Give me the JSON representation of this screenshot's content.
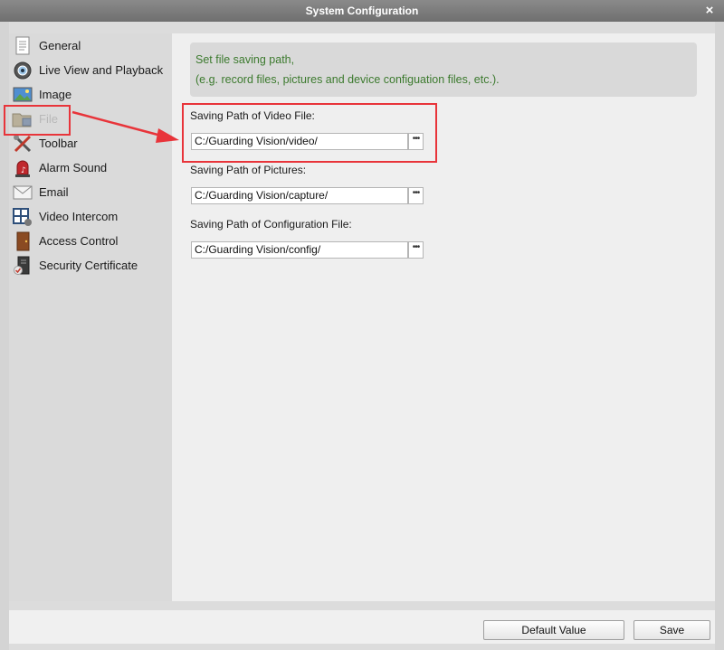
{
  "window": {
    "title": "System Configuration",
    "close_symbol": "×"
  },
  "sidebar": {
    "items": [
      {
        "label": "General",
        "icon": "document-icon"
      },
      {
        "label": "Live View and Playback",
        "icon": "camera-icon"
      },
      {
        "label": "Image",
        "icon": "picture-icon"
      },
      {
        "label": "File",
        "icon": "folder-icon",
        "state": "disabled"
      },
      {
        "label": "Toolbar",
        "icon": "tools-icon"
      },
      {
        "label": "Alarm Sound",
        "icon": "siren-icon"
      },
      {
        "label": "Email",
        "icon": "envelope-icon"
      },
      {
        "label": "Video Intercom",
        "icon": "intercom-icon"
      },
      {
        "label": "Access Control",
        "icon": "door-icon"
      },
      {
        "label": "Security Certificate",
        "icon": "certificate-icon"
      }
    ]
  },
  "info": {
    "line1": "Set file saving path,",
    "line2": "(e.g. record files, pictures and device configuation files, etc.)."
  },
  "fields": {
    "video": {
      "label": "Saving Path of Video File:",
      "value": "C:/Guarding Vision/video/"
    },
    "pictures": {
      "label": "Saving Path of Pictures:",
      "value": "C:/Guarding Vision/capture/"
    },
    "config": {
      "label": "Saving Path of Configuration File:",
      "value": "C:/Guarding Vision/config/"
    }
  },
  "browse_symbol": "•••",
  "buttons": {
    "default_value": "Default Value",
    "save": "Save"
  },
  "colors": {
    "annotation": "#e8343a",
    "info_text": "#3c7a2e",
    "titlebar": "#7d7d7d"
  }
}
